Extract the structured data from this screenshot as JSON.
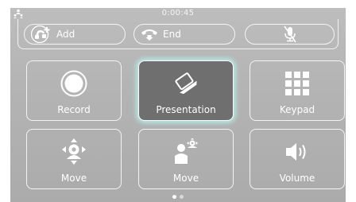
{
  "call": {
    "timer": "0:00:45",
    "add_label": "Add",
    "end_label": "End"
  },
  "tiles": [
    {
      "label": "Record",
      "icon": "record-icon"
    },
    {
      "label": "Presentation",
      "icon": "presentation-icon",
      "active": true
    },
    {
      "label": "Keypad",
      "icon": "keypad-icon"
    },
    {
      "label": "Move",
      "icon": "camera-move-icon"
    },
    {
      "label": "Move",
      "icon": "presenter-move-icon"
    },
    {
      "label": "Volume",
      "icon": "volume-icon"
    }
  ],
  "pagination": {
    "count": 2,
    "active_index": 0
  },
  "colors": {
    "background": "#b4b4b4",
    "foreground": "#ffffff",
    "active_tile": "#6f6f6f",
    "active_glow": "#b4f0eb"
  },
  "icons": {
    "corner": "conference-icon",
    "add": "add-participant-icon",
    "end": "end-call-icon",
    "mute": "microphone-muted-icon"
  }
}
